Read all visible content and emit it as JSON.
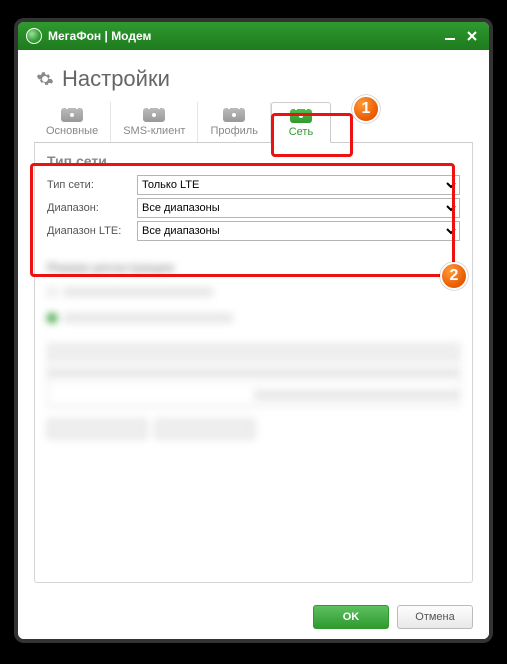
{
  "window": {
    "title": "МегаФон | Модем"
  },
  "page": {
    "title": "Настройки"
  },
  "tabs": [
    {
      "label": "Основные"
    },
    {
      "label": "SMS-клиент"
    },
    {
      "label": "Профиль"
    },
    {
      "label": "Сеть"
    }
  ],
  "section": {
    "title": "Тип сети",
    "rows": {
      "type": {
        "label": "Тип сети:",
        "value": "Только LTE"
      },
      "range": {
        "label": "Диапазон:",
        "value": "Все диапазоны"
      },
      "rangeLte": {
        "label": "Диапазон LTE:",
        "value": "Все диапазоны"
      }
    }
  },
  "blurred": {
    "title": "Режим регистрации"
  },
  "footer": {
    "ok": "OK",
    "cancel": "Отмена"
  },
  "annotations": {
    "b1": "1",
    "b2": "2"
  }
}
